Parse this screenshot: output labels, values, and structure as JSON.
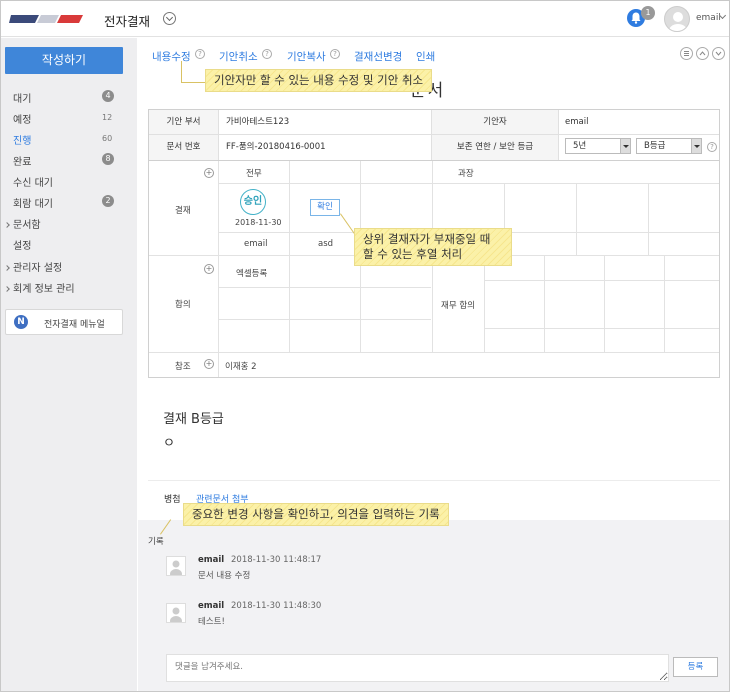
{
  "app": {
    "title": "전자결재"
  },
  "header": {
    "notification_count": "1",
    "user_name": "email"
  },
  "sidebar": {
    "compose_label": "작성하기",
    "items": [
      {
        "label": "대기",
        "count": "4"
      },
      {
        "label": "예정",
        "count": "12"
      },
      {
        "label": "진행",
        "count": "60"
      },
      {
        "label": "완료",
        "count": "8"
      },
      {
        "label": "수신 대기",
        "count": ""
      },
      {
        "label": "회람 대기",
        "count": "2"
      },
      {
        "label": "문서함",
        "count": ""
      },
      {
        "label": "설정",
        "count": ""
      },
      {
        "label": "관리자 설정",
        "count": ""
      },
      {
        "label": "회계 정보 관리",
        "count": ""
      }
    ],
    "manual_icon": "N",
    "manual_label": "전자결재 메뉴얼"
  },
  "toolbar": {
    "edit": "내용수정",
    "cancel": "기안취소",
    "copy": "기안복사",
    "line_change": "결재선변경",
    "print": "인쇄"
  },
  "document": {
    "title_fragment": "문서",
    "fields": {
      "dept_label": "기안 부서",
      "dept_value": "가비아테스트123",
      "drafter_label": "기안자",
      "drafter_value": "email",
      "docno_label": "문서 번호",
      "docno_value": "FF-품의-20180416-0001",
      "retention_label": "보존 연한 / 보안 등급",
      "retention_value": "5년",
      "security_value": "B등급"
    },
    "approval": {
      "label": "결재",
      "col1_title": "전무",
      "col2_title": "과장",
      "stamp": "승인",
      "date": "2018-11-30",
      "confirm_label": "확인",
      "signer1": "email",
      "signer2": "asd"
    },
    "agreement": {
      "label": "합의",
      "col_title": "엑셀등록",
      "finance_label": "재무 합의"
    },
    "reference": {
      "label": "참조",
      "value": "이재홍 2"
    },
    "body_line1": "결재 B등급",
    "body_line2": "ㅇ"
  },
  "tabs": {
    "opinion": "병첨",
    "related": "관련문서 첨부"
  },
  "records": {
    "label": "기록",
    "entries": [
      {
        "name": "email",
        "time": "2018-11-30 11:48:17",
        "text": "문서 내용 수정"
      },
      {
        "name": "email",
        "time": "2018-11-30 11:48:30",
        "text": "테스트!"
      }
    ],
    "comment_placeholder": "댓글을 남겨주세요.",
    "submit_label": "등록"
  },
  "callouts": {
    "c1": "기안자만 할 수 있는 내용 수정 및 기안 취소",
    "c2_line1": "상위 결재자가 부재중일 때",
    "c2_line2": "할 수 있는 후열 처리",
    "c3": "중요한 변경 사항을 확인하고, 의견을 입력하는 기록"
  },
  "colors": {
    "accent": "#2f7ce0",
    "callout": "#fbf1a8",
    "stamp": "#44b2c8"
  }
}
